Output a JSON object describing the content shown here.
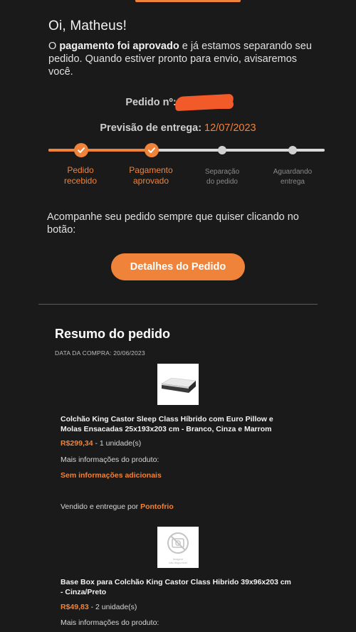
{
  "email": {
    "greeting": "Oi, Matheus!",
    "intro_prefix": "O ",
    "intro_bold": "pagamento foi aprovado",
    "intro_suffix": " e já estamos separando seu pedido. Quando estiver pronto para envio, avisaremos você.",
    "order_label": "Pedido nº:",
    "delivery_label": "Previsão de entrega:",
    "delivery_date": "12/07/2023",
    "follow_text": "Acompanhe seu pedido sempre que quiser clicando no botão:",
    "details_button": "Detalhes do Pedido"
  },
  "progress": {
    "completed_steps": 2,
    "total_steps": 4,
    "steps": [
      {
        "line1": "Pedido",
        "line2": "recebido",
        "done": true
      },
      {
        "line1": "Pagamento",
        "line2": "aprovado",
        "done": true
      },
      {
        "line1": "Separação",
        "line2": "do pedido",
        "done": false
      },
      {
        "line1": "Aguardando",
        "line2": "entrega",
        "done": false
      }
    ]
  },
  "summary": {
    "title": "Resumo do pedido",
    "purchase_date": "DATA DA COMPRA: 20/06/2023",
    "products": [
      {
        "name": "Colchão King Castor Sleep Class Híbrido com Euro Pillow e Molas Ensacadas 25x193x203 cm - Branco, Cinza e Marrom",
        "price": "R$299,34",
        "qty": " - 1 unidade(s)",
        "more_info": "Mais informações do produto:",
        "extra": "Sem informações adicionais",
        "seller_prefix": "Vendido e entregue por ",
        "seller": "Pontofrio",
        "thumb": "mattress-image"
      },
      {
        "name": "Base Box para Colchão King Castor Class Hibrido 39x96x203 cm - Cinza/Preto",
        "price": "R$49,83",
        "qty": " - 2 unidade(s)",
        "more_info": "Mais informações do produto:",
        "thumb": "image-unavailable",
        "thumb_caption": "Imagem não disponível"
      }
    ]
  },
  "colors": {
    "accent": "#f0833a",
    "background": "#1a1a1a",
    "redaction": "#f25a2a"
  }
}
